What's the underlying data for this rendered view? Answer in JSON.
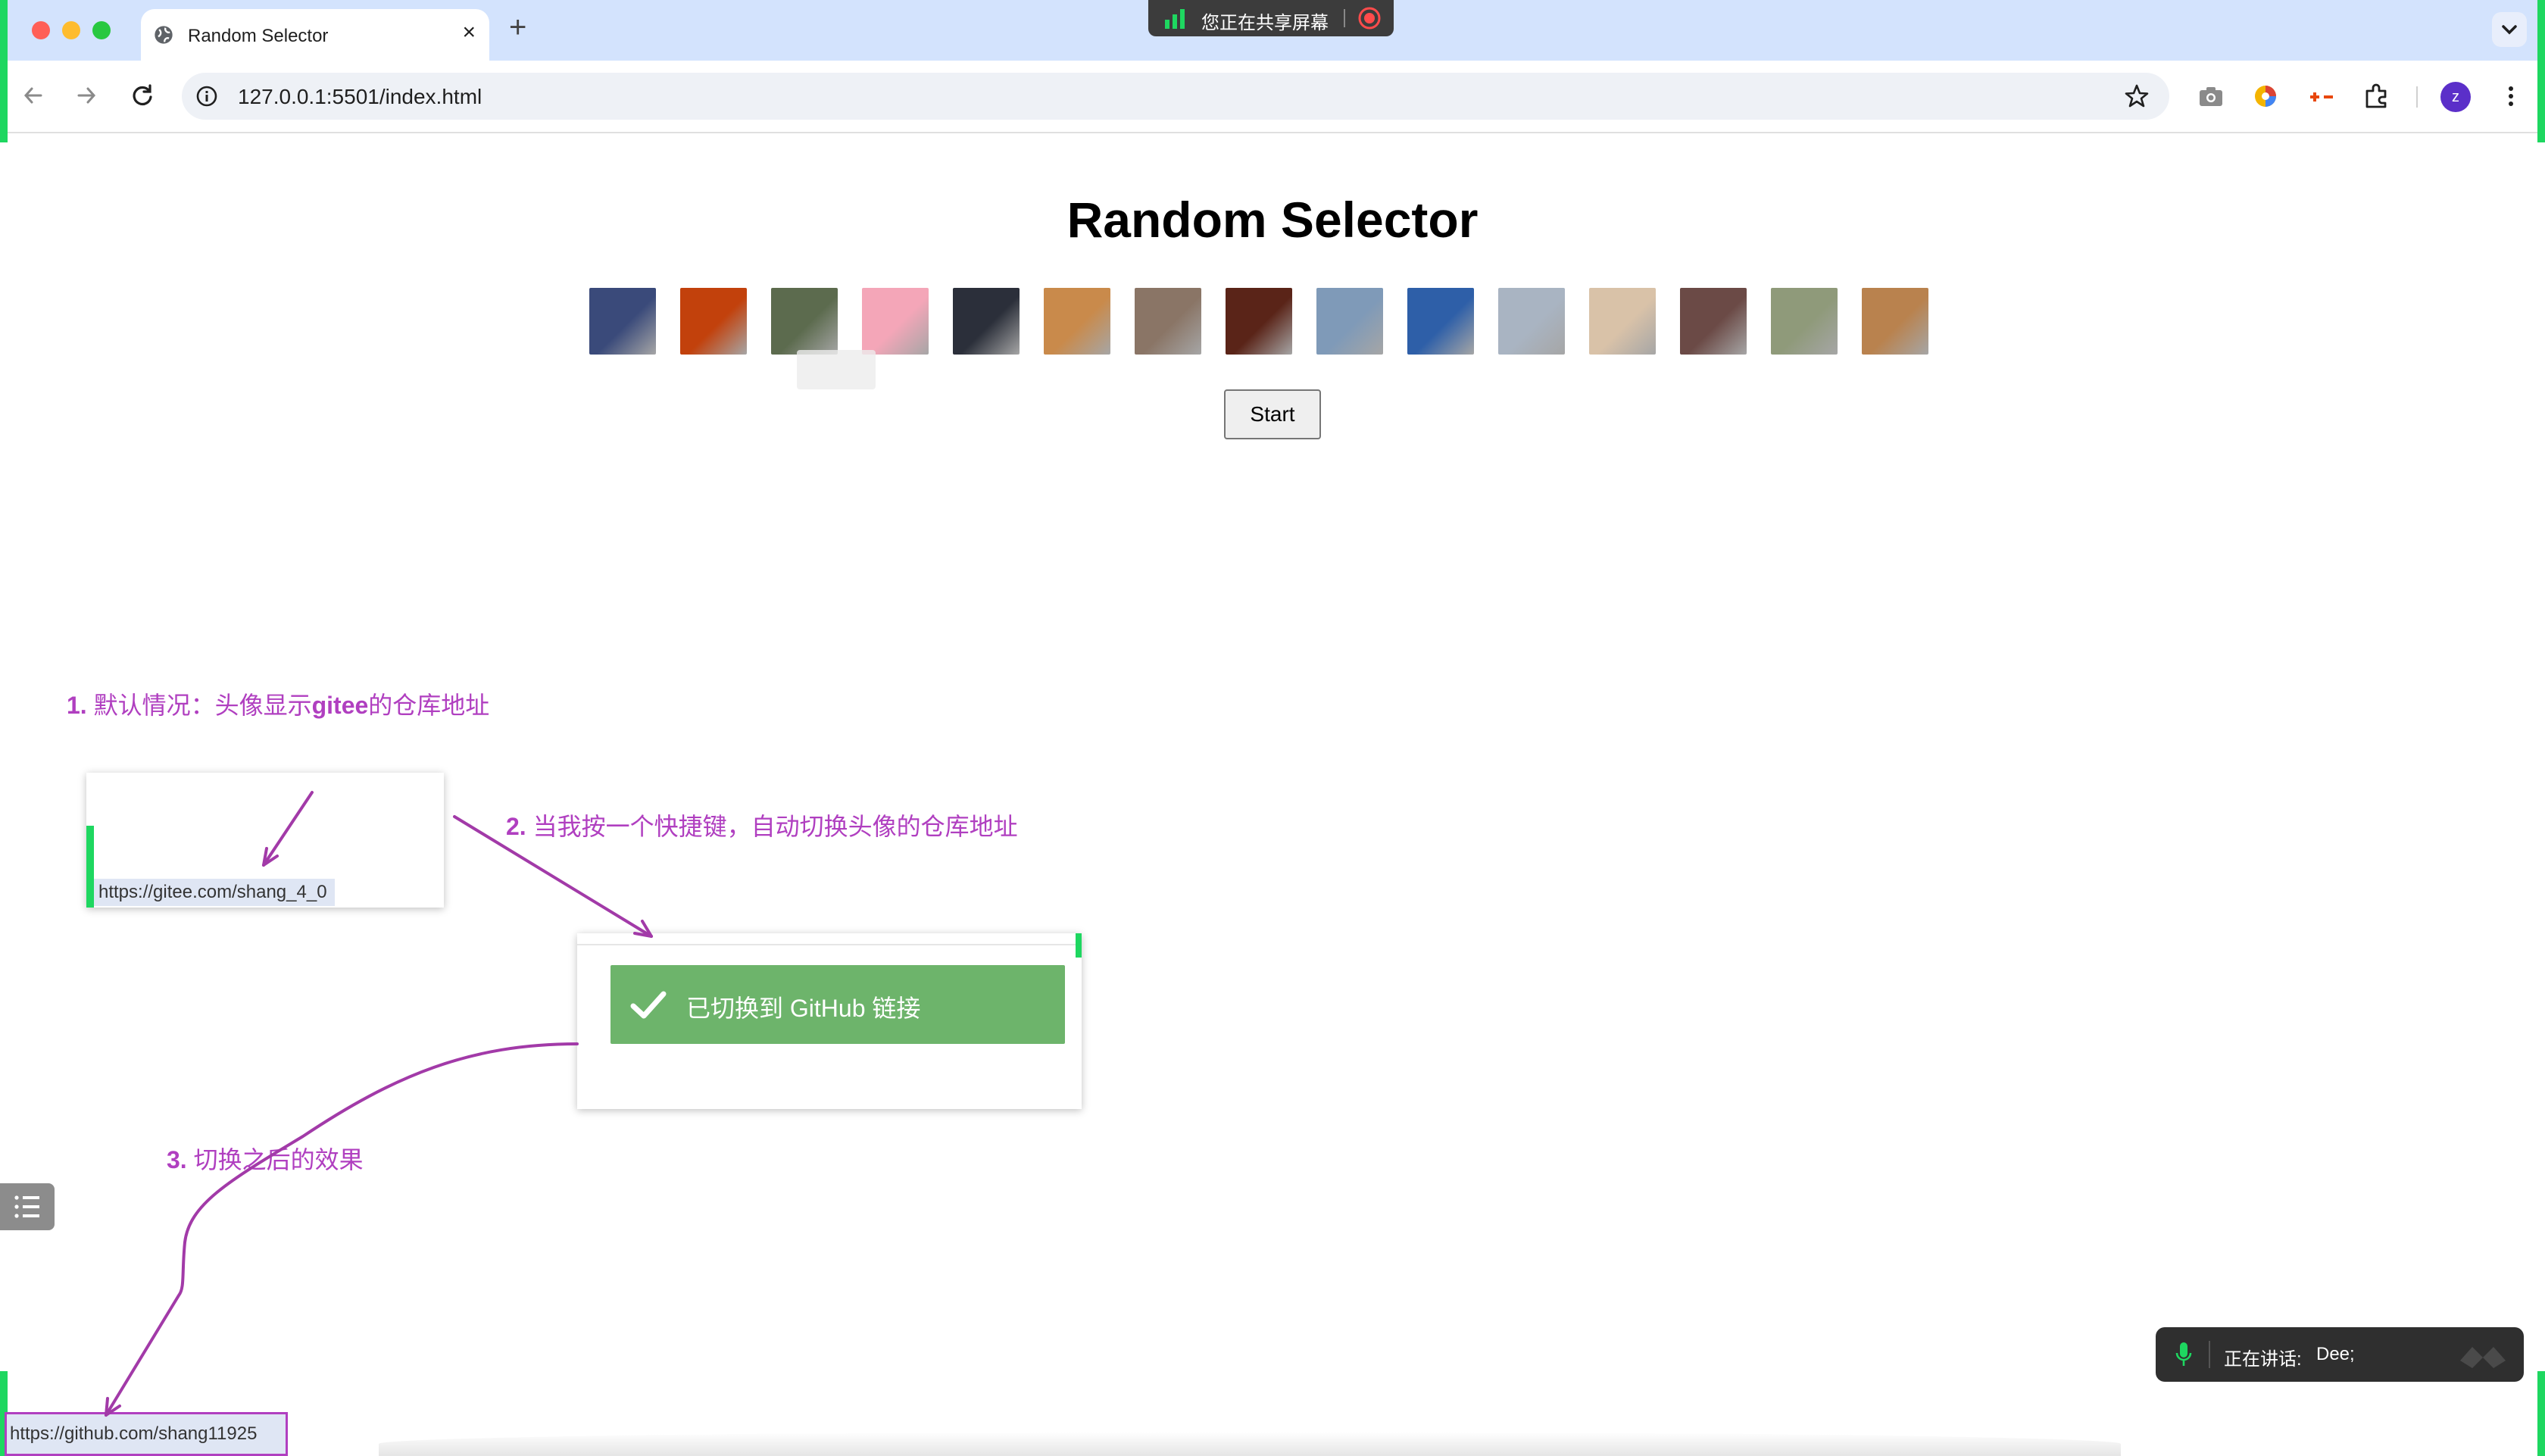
{
  "browser": {
    "tab_title": "Random Selector",
    "new_tab_glyph": "+",
    "close_glyph": "×",
    "url": "127.0.0.1:5501/index.html",
    "share_banner": "您正在共享屏幕",
    "profile_initial": "z"
  },
  "page": {
    "title": "Random Selector",
    "start_label": "Start",
    "avatars": [
      {
        "name": "avatar-1",
        "color": "#3a4a7a"
      },
      {
        "name": "avatar-2",
        "color": "#c2410c"
      },
      {
        "name": "avatar-3",
        "color": "#5c6b4e"
      },
      {
        "name": "avatar-4",
        "color": "#f4a6b8"
      },
      {
        "name": "avatar-5",
        "color": "#2b2f3a"
      },
      {
        "name": "avatar-6",
        "color": "#c98a4b"
      },
      {
        "name": "avatar-7",
        "color": "#8a7566"
      },
      {
        "name": "avatar-8",
        "color": "#5a2418"
      },
      {
        "name": "avatar-9",
        "color": "#7f9ab8"
      },
      {
        "name": "avatar-10",
        "color": "#2e5fa8"
      },
      {
        "name": "avatar-11",
        "color": "#a9b4c2"
      },
      {
        "name": "avatar-12",
        "color": "#d9c2a8"
      },
      {
        "name": "avatar-13",
        "color": "#6b4a46"
      },
      {
        "name": "avatar-14",
        "color": "#8f9a7a"
      },
      {
        "name": "avatar-15",
        "color": "#b9824e"
      }
    ]
  },
  "annotations": {
    "note1_num": "1.",
    "note1_text_a": " 默认情况：头像显示",
    "note1_bold": "gitee",
    "note1_text_b": "的仓库地址",
    "gitee_link": "https://gitee.com/shang_4_0",
    "note2_num": "2.",
    "note2_text": " 当我按一个快捷键，自动切换头像的仓库地址",
    "toast_text": "已切换到 GitHub 链接",
    "note3_num": "3.",
    "note3_text": " 切换之后的效果",
    "github_link": "https://github.com/shang11925"
  },
  "meeting": {
    "speaking_label": "正在讲话:",
    "speaker": "Dee;"
  },
  "colors": {
    "annotation": "#b03fc0",
    "toast": "#6db46b",
    "share_green": "#1ed760"
  }
}
